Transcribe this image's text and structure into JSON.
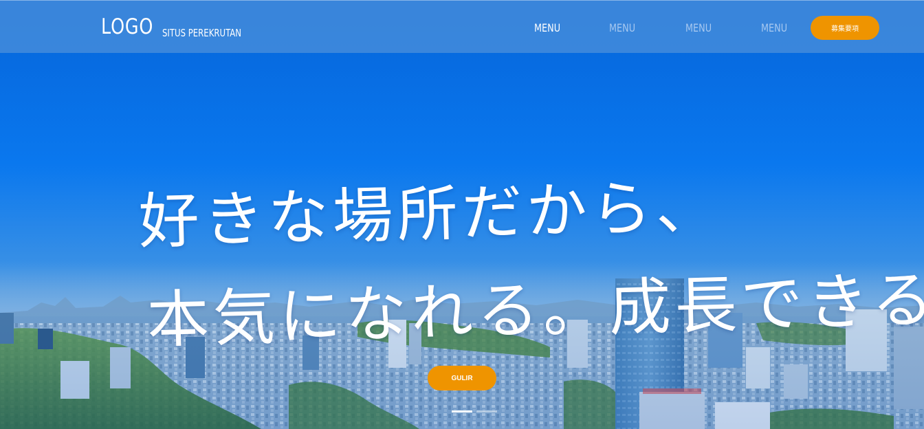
{
  "header": {
    "logo": "LOGO",
    "site_name": "SITUS PEREKRUTAN",
    "nav": [
      {
        "label": "MENU",
        "active": true
      },
      {
        "label": "MENU",
        "active": false
      },
      {
        "label": "MENU",
        "active": false
      },
      {
        "label": "MENU",
        "active": false
      }
    ],
    "cta_label": "募集要項"
  },
  "hero": {
    "headline_line1": "好きな場所だから、",
    "headline_line2": "本気になれる。成長できる。",
    "scroll_label": "GULIR",
    "slides": {
      "count": 2,
      "active_index": 0
    }
  },
  "colors": {
    "accent": "#ef9400",
    "header_bg": "#428adb",
    "sky": "#0a79ef"
  }
}
